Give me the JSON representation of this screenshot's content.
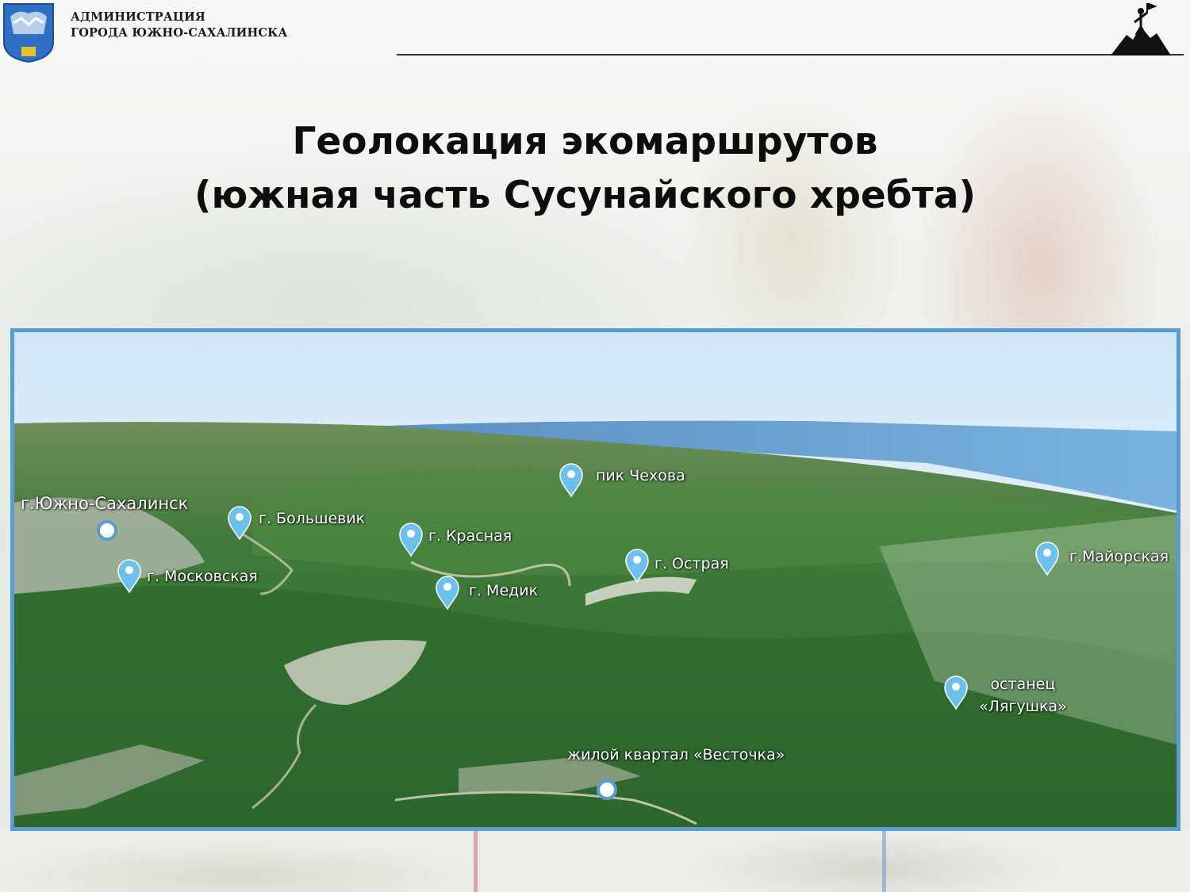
{
  "header": {
    "org_line1": "АДМИНИСТРАЦИЯ",
    "org_line2": "ГОРОДА ЮЖНО-САХАЛИНСКА",
    "emblem_icon": "city-coat-of-arms-icon",
    "logo_icon": "hiker-on-summit-icon"
  },
  "title": {
    "line1": "Геолокация экомаршрутов",
    "line2": "(южная часть Сусунайского хребта)"
  },
  "map": {
    "accent_color": "#5b9bd5",
    "pin_icon": "map-pin-icon",
    "locations": {
      "yuzhno": "г.Южно-Сахалинск",
      "bolshevik": "г. Большевик",
      "chekhov": "пик Чехова",
      "krasnaya": "г. Красная",
      "moskovskaya": "г. Московская",
      "medik": "г. Медик",
      "ostraya": "г. Острая",
      "mayorskaya": "г.Майорская",
      "lyagushka_1": "останец",
      "lyagushka_2": "«Лягушка»",
      "vestochka": "жилой квартал «Весточка»"
    }
  }
}
